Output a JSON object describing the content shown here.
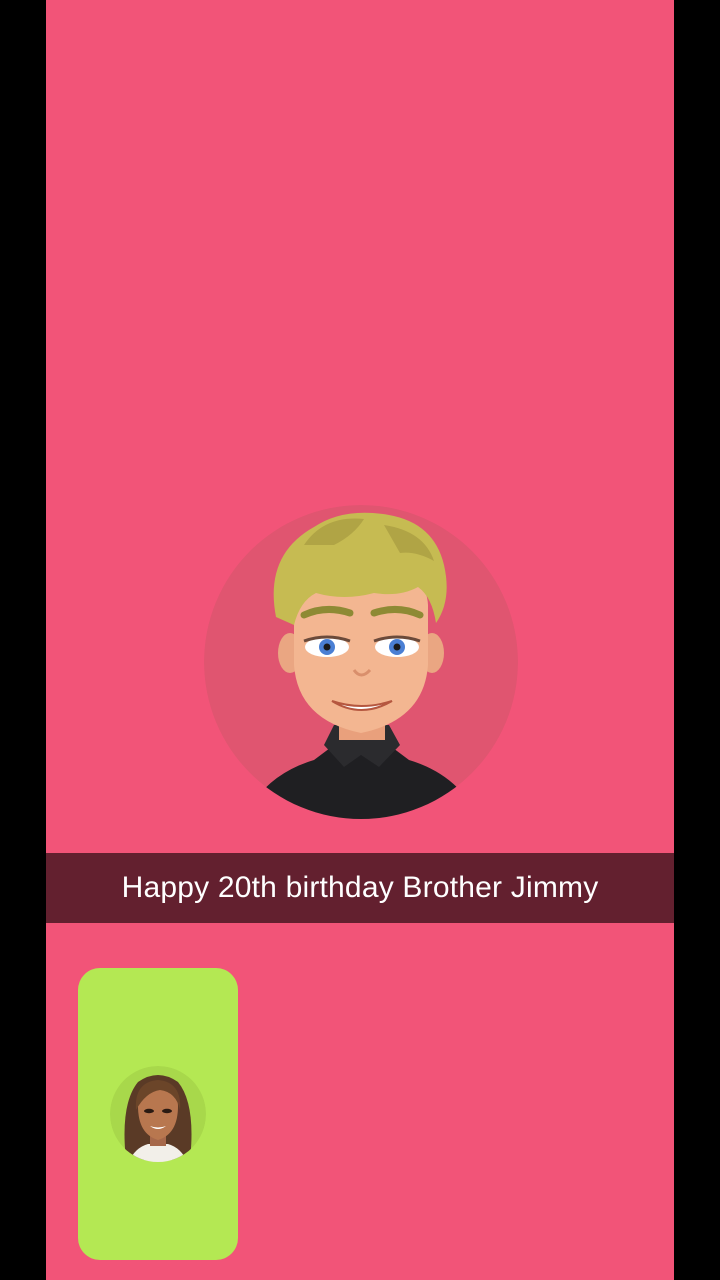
{
  "call": {
    "caption": "Happy 20th birthday Brother Jimmy"
  },
  "colors": {
    "background": "#f25478",
    "caption_bar": "#63202f",
    "self_view": "#b4e853"
  },
  "icons": {
    "remote_avatar": "male-avatar-icon",
    "self_avatar": "female-avatar-icon"
  }
}
